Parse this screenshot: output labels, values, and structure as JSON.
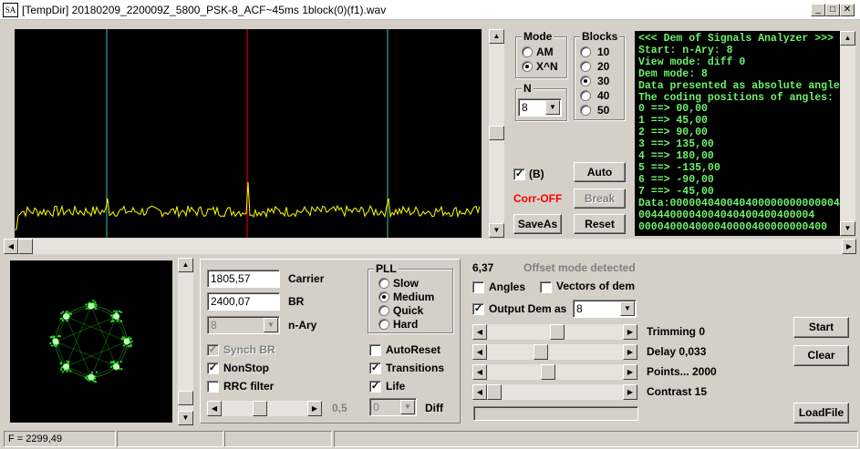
{
  "window": {
    "title": "[TempDir] 20180209_220009Z_5800_PSK-8_ACF~45ms 1block(0)(f1).wav",
    "app_icon": "SA"
  },
  "mode": {
    "label": "Mode",
    "options": [
      "AM",
      "X^N"
    ],
    "selected": 1
  },
  "blocks": {
    "label": "Blocks",
    "options": [
      "10",
      "20",
      "30",
      "40",
      "50"
    ],
    "selected": 2
  },
  "n": {
    "label": "N",
    "value": "8"
  },
  "b_check": {
    "label": "(B)",
    "checked": true
  },
  "corr_status": "Corr-OFF",
  "buttons": {
    "auto": "Auto",
    "break": "Break",
    "saveas": "SaveAs",
    "reset": "Reset",
    "start": "Start",
    "clear": "Clear",
    "loadfile": "LoadFile"
  },
  "terminal": {
    "lines": [
      "<<< Dem of Signals Analyzer >>>",
      "Start: n-Ary: 8",
      "View mode: diff 0",
      "Dem mode: 8",
      "Data presented as absolute angles!",
      "The coding positions of angles:",
      "0 ==> 00,00",
      "1 ==> 45,00",
      "2 ==> 90,00",
      "3 ==> 135,00",
      "4 ==> 180,00",
      "5 ==> -135,00",
      "6 ==> -90,00",
      "7 ==> -45,00",
      "Data:0000040400404000000000000040",
      "0044400004004040400400400004",
      "000040004000040000400000000400"
    ]
  },
  "fields": {
    "carrier": {
      "value": "1805,57",
      "label": "Carrier"
    },
    "br": {
      "value": "2400,07",
      "label": "BR"
    },
    "nary": {
      "value": "8",
      "label": "n-Ary"
    }
  },
  "pll": {
    "label": "PLL",
    "options": [
      "Slow",
      "Medium",
      "Quick",
      "Hard"
    ],
    "selected": 1
  },
  "checks": {
    "synch_br": {
      "label": "Synch BR",
      "checked": true,
      "disabled": true
    },
    "nonstop": {
      "label": "NonStop",
      "checked": true
    },
    "rrc": {
      "label": "RRC filter",
      "checked": false
    },
    "autoreset": {
      "label": "AutoReset",
      "checked": false
    },
    "transitions": {
      "label": "Transitions",
      "checked": true
    },
    "life": {
      "label": "Life",
      "checked": true
    }
  },
  "rrc_value": "0,5",
  "diff": {
    "value": "0",
    "label": "Diff"
  },
  "offset": {
    "value": "6,37",
    "label": "Offset mode detected"
  },
  "angles": {
    "label": "Angles",
    "checked": false
  },
  "vectors": {
    "label": "Vectors of dem",
    "checked": false
  },
  "output_dem": {
    "label": "Output Dem as",
    "checked": true,
    "value": "8"
  },
  "sliders": {
    "trimming": {
      "label": "Trimming 0",
      "level": 0.52
    },
    "delay": {
      "label": "Delay  0,033",
      "level": 0.38
    },
    "points": {
      "label": "Points... 2000",
      "level": 0.44
    },
    "contrast": {
      "label": "Contrast 15",
      "level": 0.0
    }
  },
  "status": {
    "freq": "F = 2299,49"
  },
  "colors": {
    "spectrum_bg": "#000000",
    "trace": "#ffff00",
    "center_marker": "#ff0000",
    "side_marker": "#40c0c0",
    "terminal_text": "#6df26d",
    "constellation": "#22cc22",
    "corr_text": "#ff0000"
  }
}
